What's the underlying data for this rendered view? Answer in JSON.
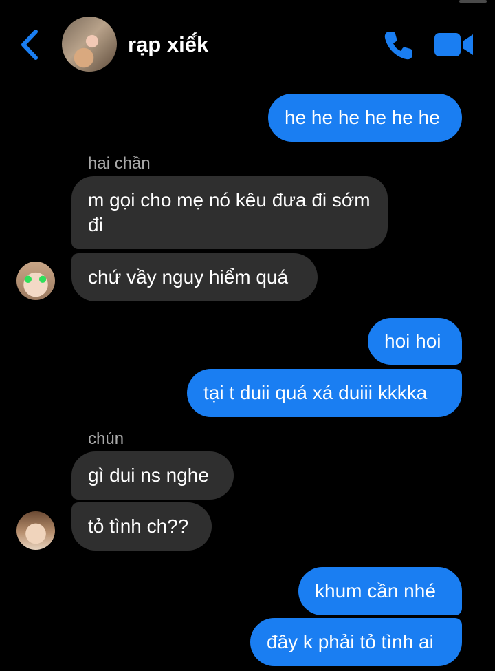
{
  "header": {
    "title": "rạp xiế́k",
    "back_icon": "chevron-left-icon",
    "call_icon": "phone-icon",
    "video_icon": "video-camera-icon",
    "accent": "#1a7ef2"
  },
  "messages": {
    "m1": "he he he he he he",
    "sender1": "hai chần",
    "m2": "m gọi cho mẹ nó kêu đưa đi sớm đi",
    "m3": "chứ vầy nguy hiểm quá",
    "m4": "hoi hoi",
    "m5": "tại t duii quá xá duiii kkkka",
    "sender2": "chún",
    "m6": "gì dui ns nghe",
    "m7": "tỏ tình ch??",
    "m8": "khum cần nhé",
    "m9": "đây k phải tỏ tình ai"
  }
}
